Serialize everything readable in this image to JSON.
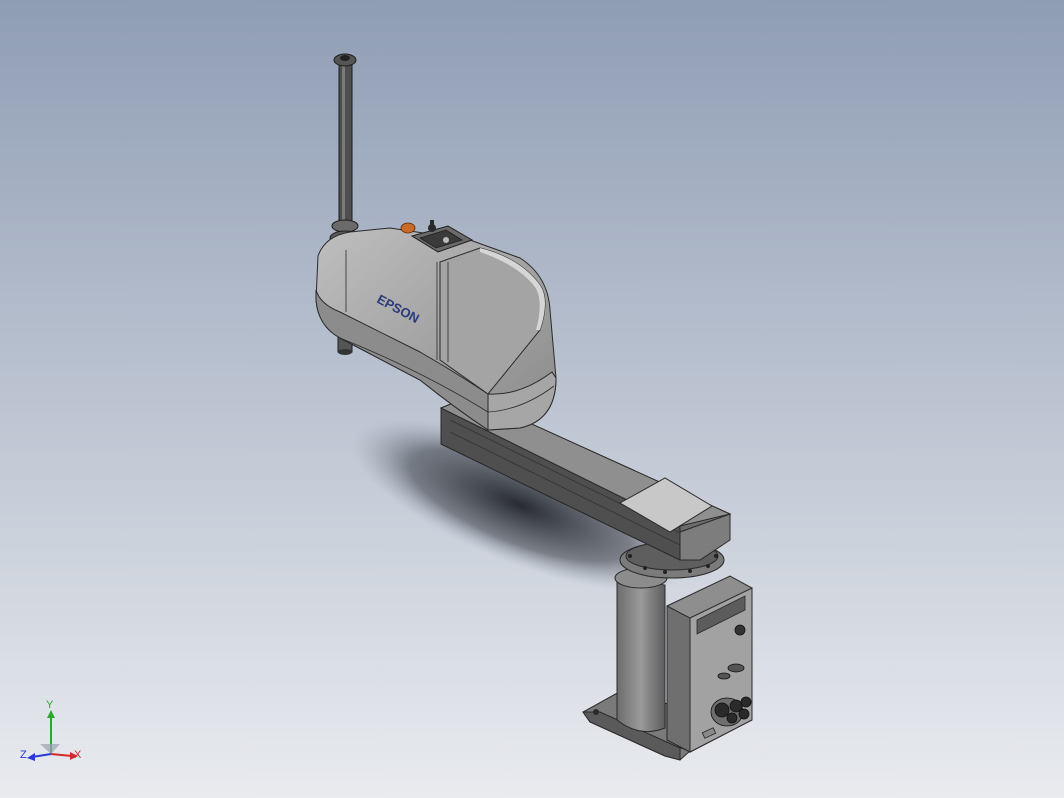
{
  "viewport": {
    "background_top": "#8f9db4",
    "background_bottom": "#e9ebef"
  },
  "model": {
    "brand_label": "EPSON",
    "brand_color": "#2a3a7a",
    "body_color": "#9a9a9a",
    "dark_color": "#4a4a4a",
    "light_color": "#c4c4c4",
    "lamp_color": "#c86a28"
  },
  "triad": {
    "x_label": "X",
    "y_label": "Y",
    "z_label": "Z",
    "x_color": "#d22a2a",
    "y_color": "#2aa82a",
    "z_color": "#2a3ad2"
  }
}
